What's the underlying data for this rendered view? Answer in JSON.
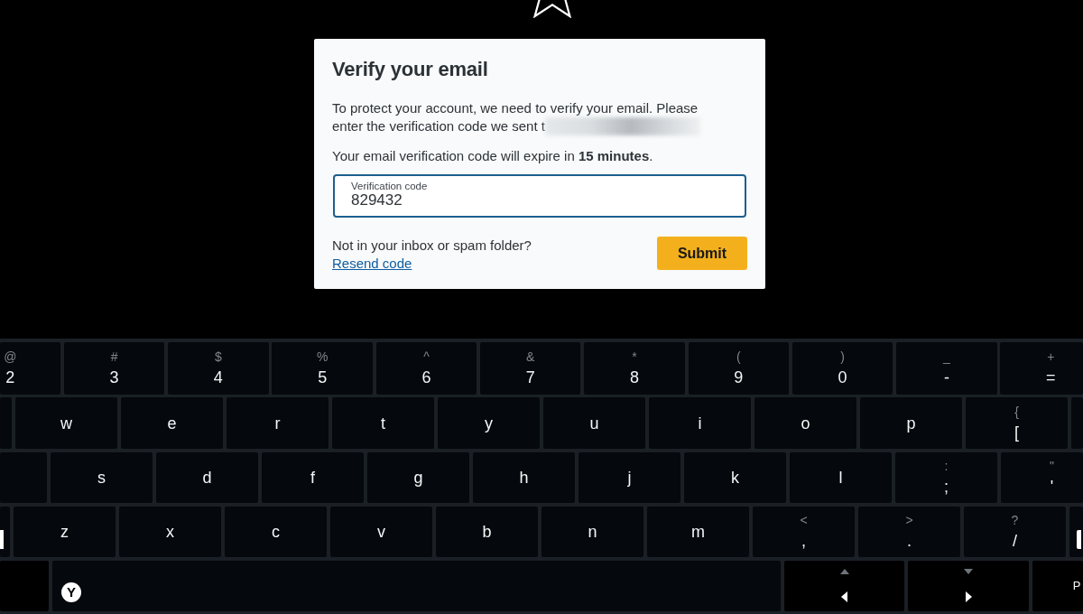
{
  "dialog": {
    "title": "Verify your email",
    "message": "To protect your account, we need to verify your email. Please enter the verification code we sent t",
    "message_blurred_tail": true,
    "expiry_note": "Your email verification code will expire in **15 minutes**.",
    "code_field": {
      "label": "Verification code",
      "value": "829432"
    },
    "help_text": "Not in your inbox or spam folder?",
    "resend_link": "Resend code",
    "submit_button": "Submit"
  },
  "keyboard": {
    "rows": [
      [
        {
          "kind": "key",
          "shift": "@",
          "label": "2"
        },
        {
          "kind": "key",
          "shift": "#",
          "label": "3"
        },
        {
          "kind": "key",
          "shift": "$",
          "label": "4"
        },
        {
          "kind": "key",
          "shift": "%",
          "label": "5"
        },
        {
          "kind": "key",
          "shift": "^",
          "label": "6"
        },
        {
          "kind": "key",
          "shift": "&",
          "label": "7"
        },
        {
          "kind": "key",
          "shift": "*",
          "label": "8"
        },
        {
          "kind": "key",
          "shift": "(",
          "label": "9"
        },
        {
          "kind": "key",
          "shift": ")",
          "label": "0"
        },
        {
          "kind": "key",
          "shift": "_",
          "label": "-"
        },
        {
          "kind": "key",
          "shift": "+",
          "label": "="
        }
      ],
      [
        {
          "kind": "blank"
        },
        {
          "kind": "key",
          "label": "w"
        },
        {
          "kind": "key",
          "label": "e"
        },
        {
          "kind": "key",
          "label": "r"
        },
        {
          "kind": "key",
          "label": "t"
        },
        {
          "kind": "key",
          "label": "y"
        },
        {
          "kind": "key",
          "label": "u"
        },
        {
          "kind": "key",
          "label": "i"
        },
        {
          "kind": "key",
          "label": "o"
        },
        {
          "kind": "key",
          "label": "p"
        },
        {
          "kind": "key",
          "shift": "{",
          "label": "["
        },
        {
          "kind": "blank"
        }
      ],
      [
        {
          "kind": "blank"
        },
        {
          "kind": "key",
          "label": "s"
        },
        {
          "kind": "key",
          "label": "d"
        },
        {
          "kind": "key",
          "label": "f"
        },
        {
          "kind": "key",
          "label": "g"
        },
        {
          "kind": "key",
          "label": "h"
        },
        {
          "kind": "key",
          "label": "j"
        },
        {
          "kind": "key",
          "label": "k"
        },
        {
          "kind": "key",
          "label": "l"
        },
        {
          "kind": "key",
          "shift": ":",
          "label": ";"
        },
        {
          "kind": "key",
          "shift": "\"",
          "label": "'"
        }
      ],
      [
        {
          "kind": "stub"
        },
        {
          "kind": "key",
          "label": "z"
        },
        {
          "kind": "key",
          "label": "x"
        },
        {
          "kind": "key",
          "label": "c"
        },
        {
          "kind": "key",
          "label": "v"
        },
        {
          "kind": "key",
          "label": "b"
        },
        {
          "kind": "key",
          "label": "n"
        },
        {
          "kind": "key",
          "label": "m"
        },
        {
          "kind": "key",
          "shift": "<",
          "label": ","
        },
        {
          "kind": "key",
          "shift": ">",
          "label": "."
        },
        {
          "kind": "key",
          "shift": "?",
          "label": "/"
        },
        {
          "kind": "stub"
        }
      ],
      [
        {
          "kind": "blank"
        },
        {
          "kind": "space",
          "hint": "Y"
        },
        {
          "kind": "prev"
        },
        {
          "kind": "next"
        },
        {
          "kind": "text",
          "label": "P"
        }
      ]
    ]
  }
}
